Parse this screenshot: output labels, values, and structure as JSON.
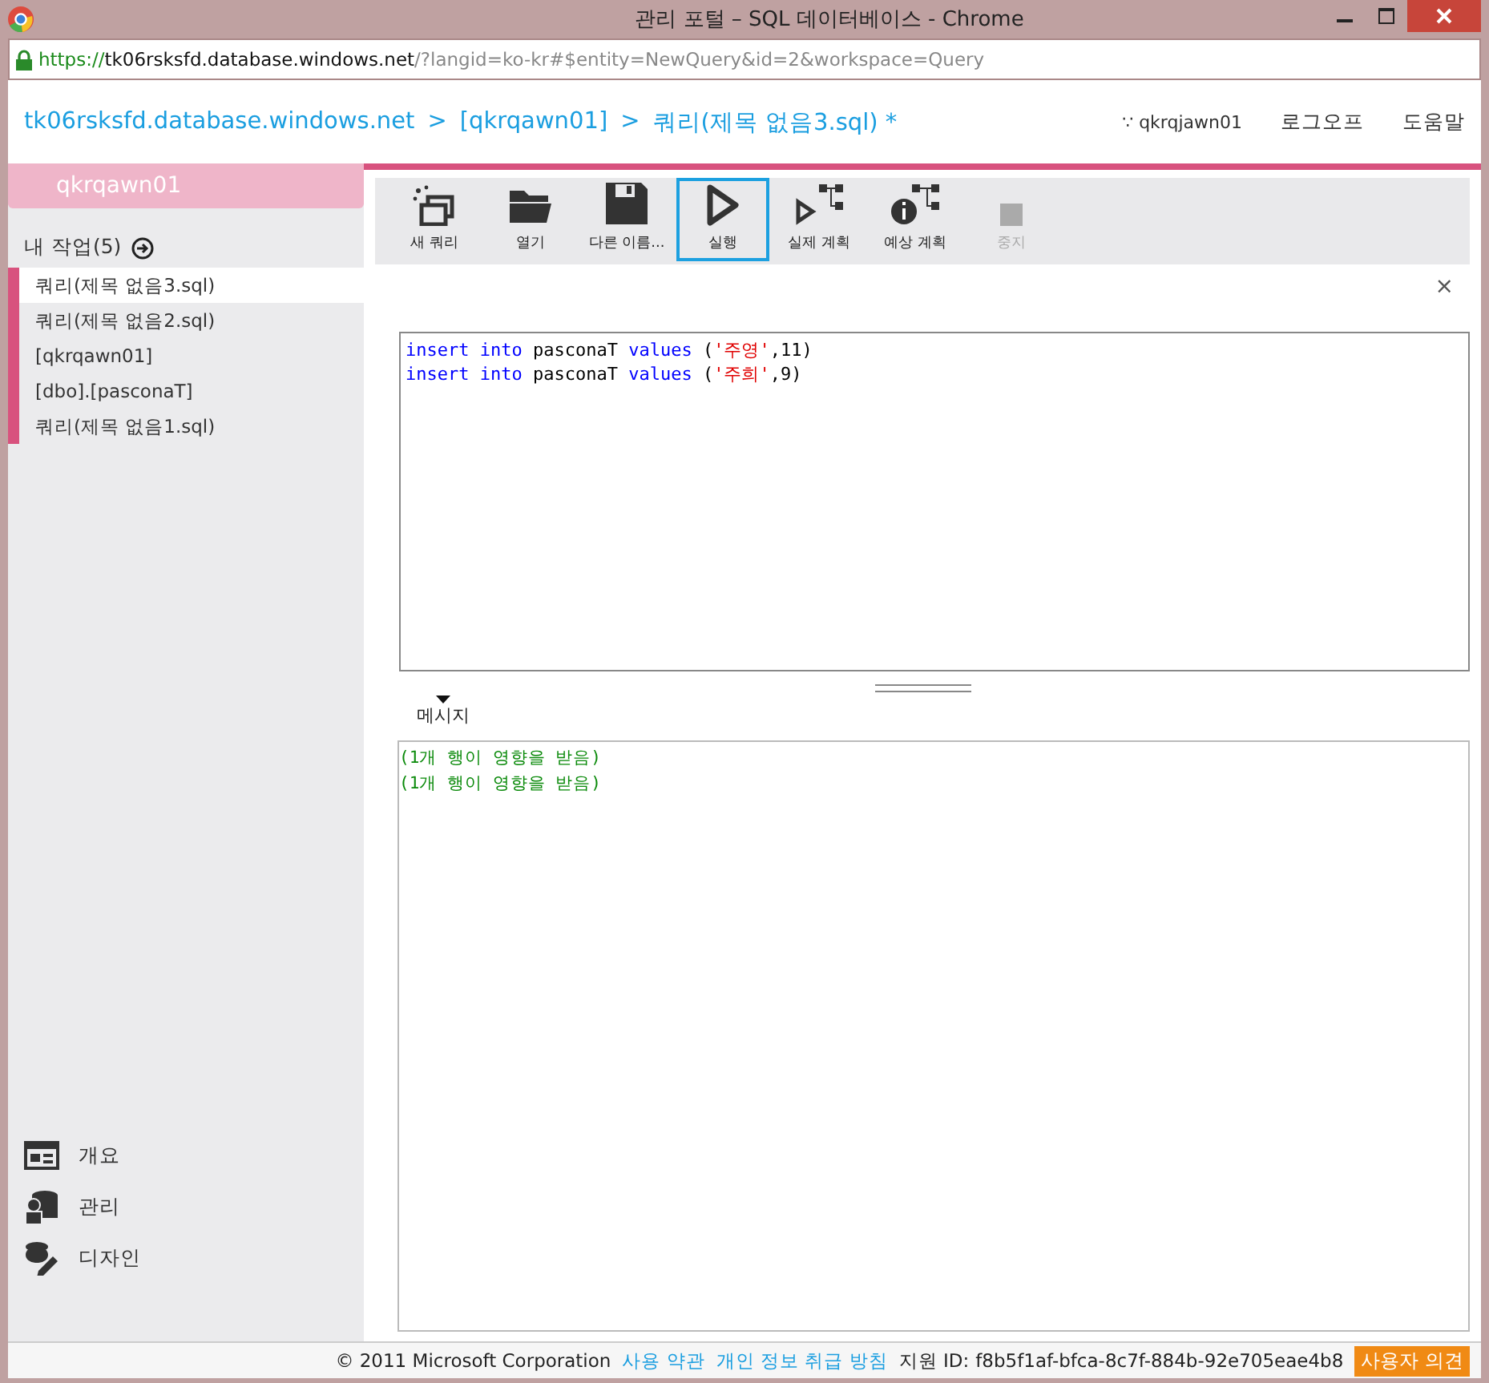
{
  "window": {
    "title": "관리 포털 – SQL 데이터베이스 - Chrome"
  },
  "address": {
    "scheme": "https://",
    "host": "tk06rsksfd.database.windows.net",
    "path": "/?langid=ko-kr#$entity=NewQuery&id=2&workspace=Query"
  },
  "breadcrumb": [
    "tk06rsksfd.database.windows.net",
    ">",
    "[qkrqawn01]",
    ">",
    "쿼리(제목 없음3.sql) *"
  ],
  "header_links": [
    {
      "label": "∵ qkrqjawn01",
      "kind": "user"
    },
    {
      "label": "로그오프",
      "kind": "link"
    },
    {
      "label": "도움말",
      "kind": "link"
    }
  ],
  "sidebar": {
    "title": "qkrqawn01",
    "section": "내 작업(5)",
    "items": [
      {
        "label": "쿼리(제목 없음3.sql)",
        "selected": true
      },
      {
        "label": "쿼리(제목 없음2.sql)",
        "selected": false
      },
      {
        "label": "[qkrqawn01]",
        "selected": false
      },
      {
        "label": "[dbo].[pasconaT]",
        "selected": false
      },
      {
        "label": "쿼리(제목 없음1.sql)",
        "selected": false
      }
    ],
    "nav": [
      {
        "label": "개요",
        "kind": "overview"
      },
      {
        "label": "관리",
        "kind": "manage"
      },
      {
        "label": "디자인",
        "kind": "design"
      }
    ]
  },
  "toolbar": [
    {
      "label": "새 쿼리",
      "kind": "new",
      "selected": false,
      "disabled": false
    },
    {
      "label": "열기",
      "kind": "open",
      "selected": false,
      "disabled": false
    },
    {
      "label": "다른 이름...",
      "kind": "save",
      "selected": false,
      "disabled": false
    },
    {
      "label": "실행",
      "kind": "run",
      "selected": true,
      "disabled": false
    },
    {
      "label": "실제 계획",
      "kind": "actual",
      "selected": false,
      "disabled": false
    },
    {
      "label": "예상 계획",
      "kind": "estimated",
      "selected": false,
      "disabled": false
    },
    {
      "label": "중지",
      "kind": "stop",
      "selected": false,
      "disabled": true
    }
  ],
  "close": "×",
  "editor": {
    "lines": [
      [
        {
          "kind": "keyword",
          "text": "insert into"
        },
        {
          "kind": "plain",
          "text": " pasconaT "
        },
        {
          "kind": "keyword",
          "text": "values"
        },
        {
          "kind": "plain",
          "text": " ("
        },
        {
          "kind": "string",
          "text": "'주영'"
        },
        {
          "kind": "plain",
          "text": ",11)"
        }
      ],
      [
        {
          "kind": "keyword",
          "text": "insert into"
        },
        {
          "kind": "plain",
          "text": " pasconaT "
        },
        {
          "kind": "keyword",
          "text": "values"
        },
        {
          "kind": "plain",
          "text": " ("
        },
        {
          "kind": "string",
          "text": "'주희'"
        },
        {
          "kind": "plain",
          "text": ",9)"
        }
      ]
    ]
  },
  "results": {
    "tab": "메시지",
    "messages": [
      "(1개 행이 영향을 받음)",
      "(1개 행이 영향을 받음)"
    ]
  },
  "footer": {
    "copyright": "© 2011 Microsoft Corporation",
    "links": [
      "사용 약관",
      "개인 정보 취급 방침"
    ],
    "support_label": "지원 ID:",
    "support_id": "f8b5f1af-bfca-8c7f-884b-92e705eae4b8",
    "feedback": "사용자 의견"
  }
}
